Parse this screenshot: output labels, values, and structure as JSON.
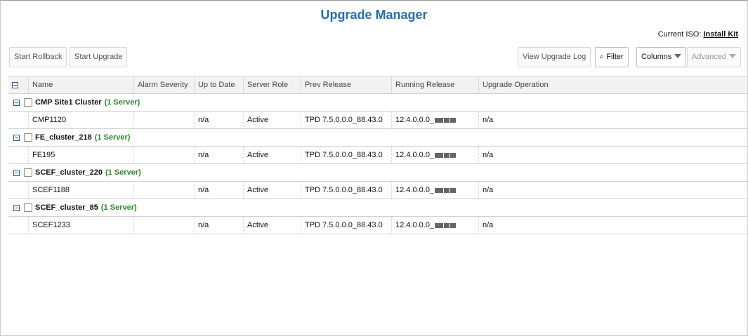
{
  "page": {
    "title": "Upgrade Manager"
  },
  "iso": {
    "label": "Current ISO:",
    "link": "Install Kit"
  },
  "toolbar": {
    "start_rollback": "Start Rollback",
    "start_upgrade": "Start Upgrade",
    "view_log": "View Upgrade Log",
    "filter": "Filter",
    "columns": "Columns",
    "advanced": "Advanced"
  },
  "columns": [
    "Name",
    "Alarm Severity",
    "Up to Date",
    "Server Role",
    "Prev Release",
    "Running Release",
    "Upgrade Operation"
  ],
  "groups": [
    {
      "name": "CMP Site1 Cluster",
      "count": "(1 Server)",
      "server": {
        "name": "CMP1120",
        "alarm": "",
        "up_to_date": "n/a",
        "role": "Active",
        "prev": "TPD 7.5.0.0.0_88.43.0",
        "running": "12.4.0.0.0_",
        "operation": "n/a"
      }
    },
    {
      "name": "FE_cluster_218",
      "count": "(1 Server)",
      "server": {
        "name": "FE195",
        "alarm": "",
        "up_to_date": "n/a",
        "role": "Active",
        "prev": "TPD 7.5.0.0.0_88.43.0",
        "running": "12.4.0.0.0_",
        "operation": "n/a"
      }
    },
    {
      "name": "SCEF_cluster_220",
      "count": "(1 Server)",
      "server": {
        "name": "SCEF1188",
        "alarm": "",
        "up_to_date": "n/a",
        "role": "Active",
        "prev": "TPD 7.5.0.0.0_88.43.0",
        "running": "12.4.0.0.0_",
        "operation": "n/a"
      }
    },
    {
      "name": "SCEF_cluster_85",
      "count": "(1 Server)",
      "server": {
        "name": "SCEF1233",
        "alarm": "",
        "up_to_date": "n/a",
        "role": "Active",
        "prev": "TPD 7.5.0.0.0_88.43.0",
        "running": "12.4.0.0.0_",
        "operation": "n/a"
      }
    }
  ],
  "colors": {
    "title": "#1f6fb3",
    "count": "#2a8a2a",
    "collapse_icon": "#2a5d8f"
  }
}
